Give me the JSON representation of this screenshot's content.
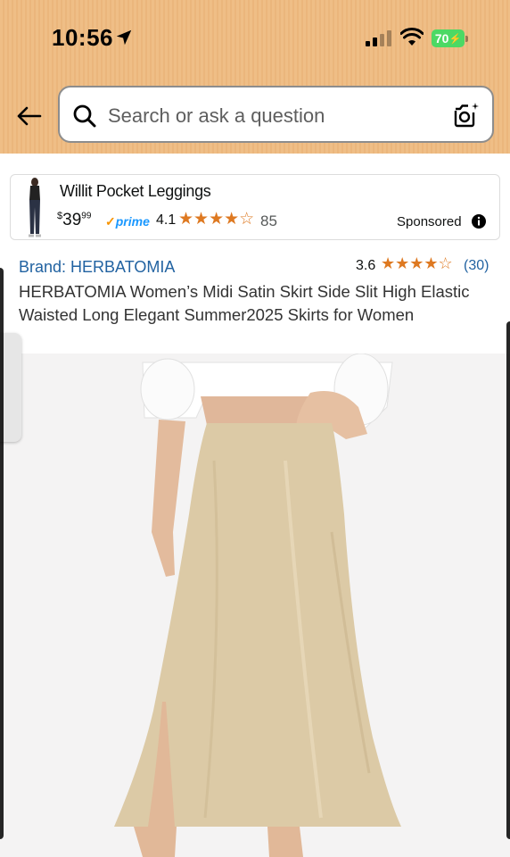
{
  "status_bar": {
    "time": "10:56",
    "battery": "70"
  },
  "search": {
    "placeholder": "Search or ask a question"
  },
  "sponsored_ad": {
    "title": "Willit Pocket Leggings",
    "price_currency": "$",
    "price_whole": "39",
    "price_fraction": "99",
    "prime_label": "prime",
    "rating": "4.1",
    "stars": "★★★★☆",
    "review_count": "85",
    "sponsored_label": "Sponsored"
  },
  "product": {
    "brand": "Brand: HERBATOMIA",
    "rating": "3.6",
    "stars": "★★★★☆",
    "review_count": "(30)",
    "title": "HERBATOMIA Women’s Midi Satin Skirt Side Slit High Elastic Waisted Long Elegant Summer2025 Skirts for Women"
  },
  "colors": {
    "header_bg": "#edba82",
    "star": "#de7921",
    "link": "#2162a1",
    "prime": "#1a98ff",
    "skirt": "#dccaa6"
  },
  "icons": [
    "location-arrow-icon",
    "signal-icon",
    "wifi-icon",
    "battery-icon",
    "back-arrow-icon",
    "search-icon",
    "camera-search-icon",
    "info-icon"
  ]
}
